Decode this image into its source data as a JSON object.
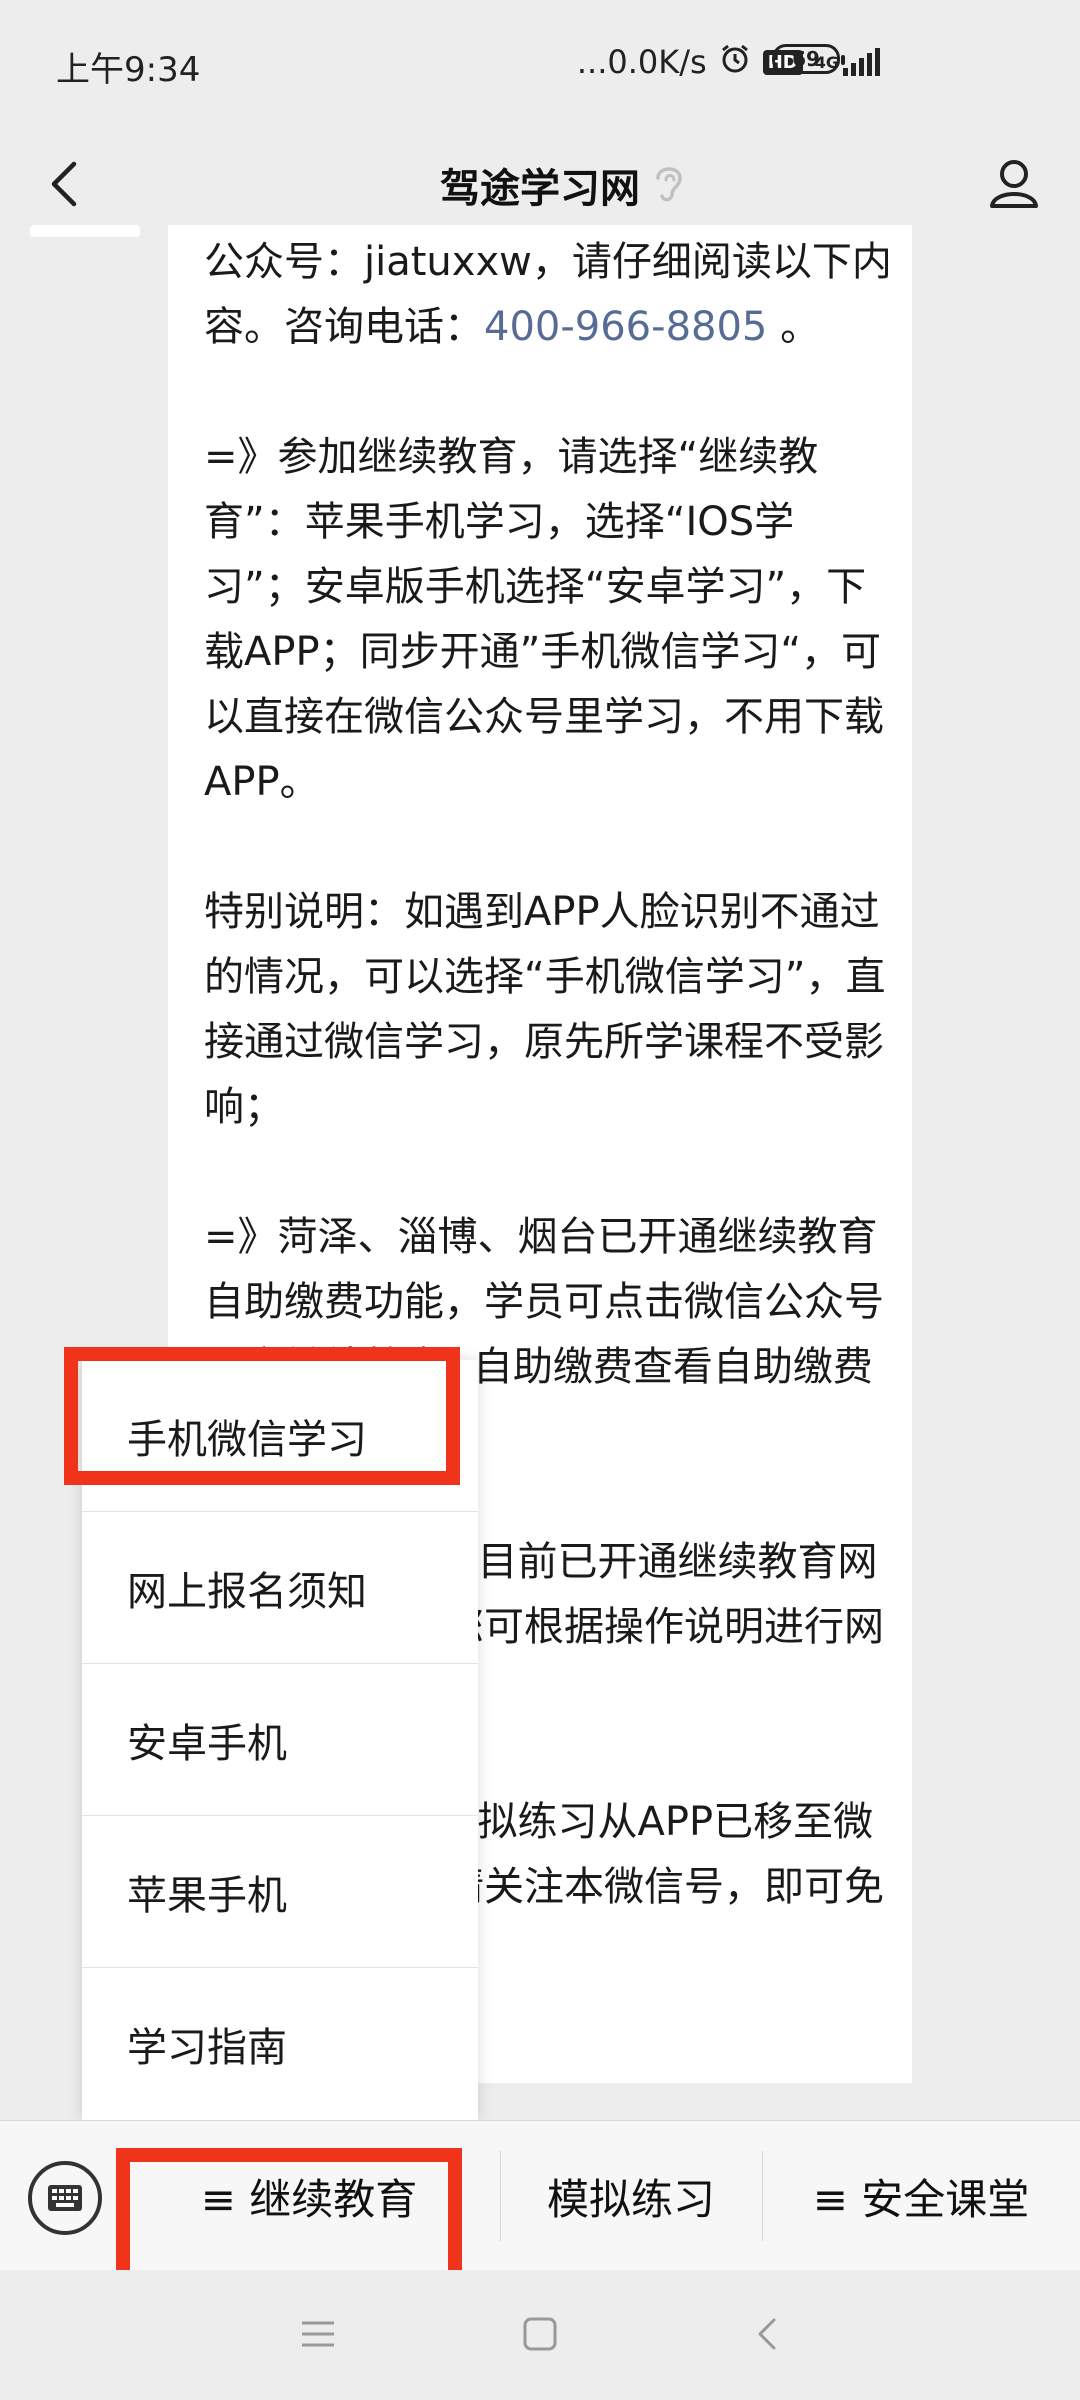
{
  "status_bar": {
    "time": "上午9:34",
    "net_speed": "...0.0K/s",
    "network_type": "4G",
    "hd_label": "HD",
    "battery": "69"
  },
  "nav": {
    "title": "驾途学习网"
  },
  "article": {
    "p1_a": "公众号：jiatuxxw，请仔细阅读以下内容。咨询电话：",
    "phone": "400-966-8805",
    "p1_b": " 。",
    "p2": "=》参加继续教育，请选择“继续教育”：苹果手机学习，选择“IOS学习”；安卓版手机选择“安卓学习”，下载APP；同步开通”手机微信学习“，可以直接在微信公众号里学习，不用下载APP。",
    "p3": "特别说明：如遇到APP人脸识别不通过的情况，可以选择“手机微信学习”，直接通过微信学习，原先所学课程不受影响；",
    "p4": "=》菏泽、淄博、烟台已开通继续教育自助缴费功能，学员可点击微信公众号下方继续教育--自助缴费查看自助缴费流程；",
    "p5": "=》菏泽、烟台目前已开通继续教育网上报名业务，您可根据操作说明进行网上报名。",
    "p6": "=》安全课堂模拟练习从APP已移至微信公众号里，请关注本微信号，即可免费学习。"
  },
  "popup_menu": {
    "items": [
      "手机微信学习",
      "网上报名须知",
      "安卓手机",
      "苹果手机",
      "学习指南"
    ]
  },
  "menu_bar": {
    "item1": "≡ 继续教育",
    "item2": "模拟练习",
    "item3": "≡ 安全课堂"
  },
  "colors": {
    "highlight": "#f0341c",
    "link": "#576b95",
    "background": "#ededed"
  }
}
